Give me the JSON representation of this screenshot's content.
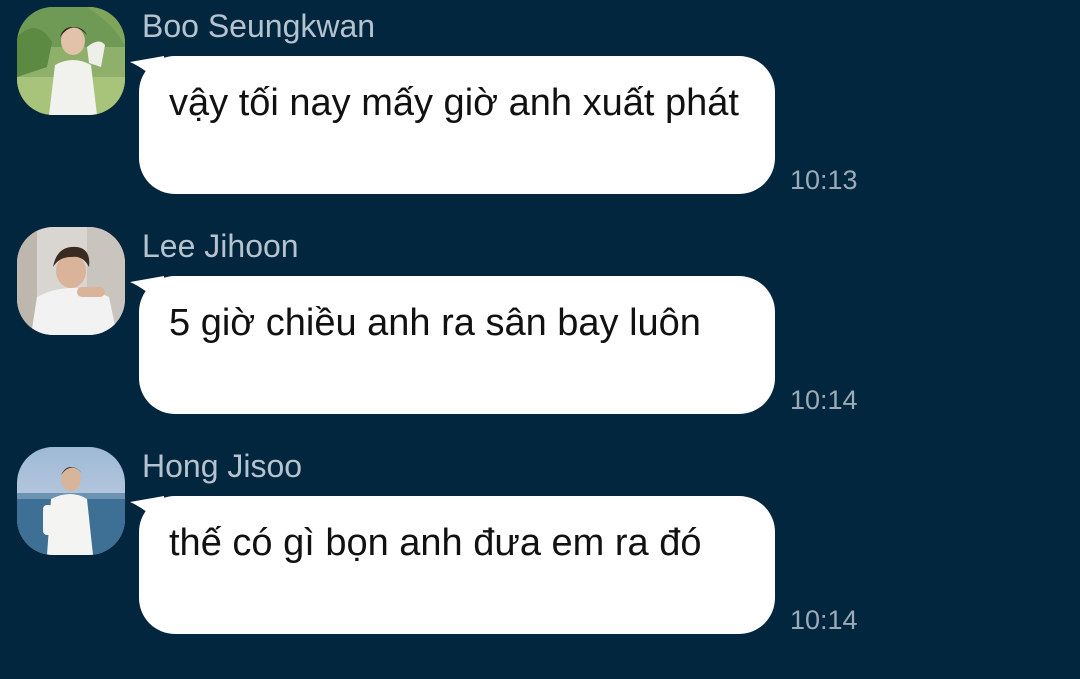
{
  "messages": [
    {
      "sender": "Boo Seungkwan",
      "text": "vậy tối nay mấy giờ anh xuất phát",
      "time": "10:13",
      "avatar": "boo-seungkwan-avatar"
    },
    {
      "sender": "Lee Jihoon",
      "text": "5 giờ chiều anh ra sân bay luôn",
      "time": "10:14",
      "avatar": "lee-jihoon-avatar"
    },
    {
      "sender": "Hong Jisoo",
      "text": "thế có gì bọn anh đưa em ra đó",
      "time": "10:14",
      "avatar": "hong-jisoo-avatar"
    }
  ],
  "colors": {
    "background": "#03263f",
    "bubble": "#ffffff",
    "sender_name": "#b4c3cf",
    "timestamp": "#9aaab6"
  }
}
